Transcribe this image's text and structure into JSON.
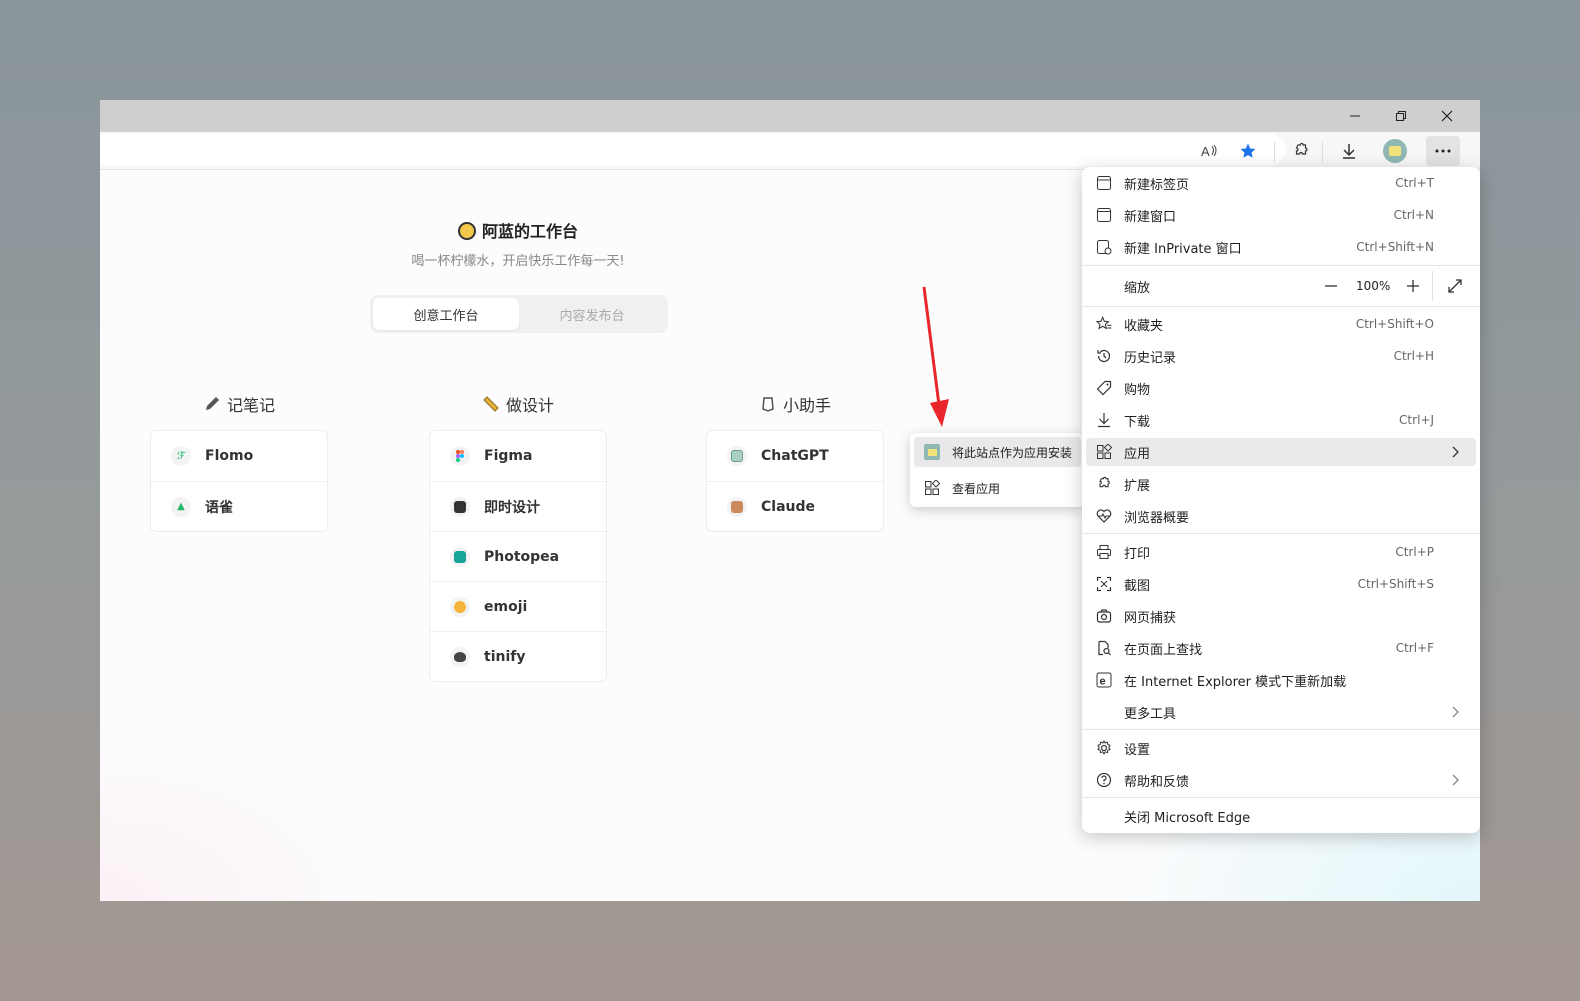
{
  "window": {
    "controls": [
      "minimize-icon",
      "restore-icon",
      "close-icon"
    ]
  },
  "toolbar": {
    "icons": [
      "read-aloud-icon",
      "favorite-star-icon",
      "extensions-icon",
      "download-icon",
      "profile-avatar",
      "more-icon"
    ],
    "accent": "#1a73e8"
  },
  "page": {
    "title": "阿蓝的工作台",
    "subtitle": "喝一杯柠檬水，开启快乐工作每一天!",
    "tabs": [
      {
        "label": "创意工作台",
        "active": true
      },
      {
        "label": "内容发布台",
        "active": false
      }
    ],
    "columns": [
      {
        "title": "记笔记",
        "icon": "pencil-icon",
        "items": [
          "Flomo",
          "语雀"
        ]
      },
      {
        "title": "做设计",
        "icon": "ruler-icon",
        "items": [
          "Figma",
          "即时设计",
          "Photopea",
          "emoji",
          "tinify"
        ]
      },
      {
        "title": "小助手",
        "icon": "robot-icon",
        "items": [
          "ChatGPT",
          "Claude"
        ]
      }
    ]
  },
  "menu": {
    "new_tab": {
      "label": "新建标签页",
      "shortcut": "Ctrl+T"
    },
    "new_window": {
      "label": "新建窗口",
      "shortcut": "Ctrl+N"
    },
    "new_inprivate": {
      "label": "新建 InPrivate 窗口",
      "shortcut": "Ctrl+Shift+N"
    },
    "zoom": {
      "label": "缩放",
      "value": "100%"
    },
    "favorites": {
      "label": "收藏夹",
      "shortcut": "Ctrl+Shift+O"
    },
    "history": {
      "label": "历史记录",
      "shortcut": "Ctrl+H"
    },
    "shopping": {
      "label": "购物"
    },
    "downloads": {
      "label": "下载",
      "shortcut": "Ctrl+J"
    },
    "apps": {
      "label": "应用"
    },
    "extensions": {
      "label": "扩展"
    },
    "essentials": {
      "label": "浏览器概要"
    },
    "print": {
      "label": "打印",
      "shortcut": "Ctrl+P"
    },
    "screenshot": {
      "label": "截图",
      "shortcut": "Ctrl+Shift+S"
    },
    "web_capture": {
      "label": "网页捕获"
    },
    "find": {
      "label": "在页面上查找",
      "shortcut": "Ctrl+F"
    },
    "ie_mode": {
      "label": "在 Internet Explorer 模式下重新加载"
    },
    "more_tools": {
      "label": "更多工具"
    },
    "settings": {
      "label": "设置"
    },
    "help": {
      "label": "帮助和反馈"
    },
    "close_edge": {
      "label": "关闭 Microsoft Edge"
    }
  },
  "submenu": {
    "install": {
      "label": "将此站点作为应用安装"
    },
    "view_apps": {
      "label": "查看应用"
    }
  },
  "annotation": {
    "arrow_color": "#e8262b"
  }
}
